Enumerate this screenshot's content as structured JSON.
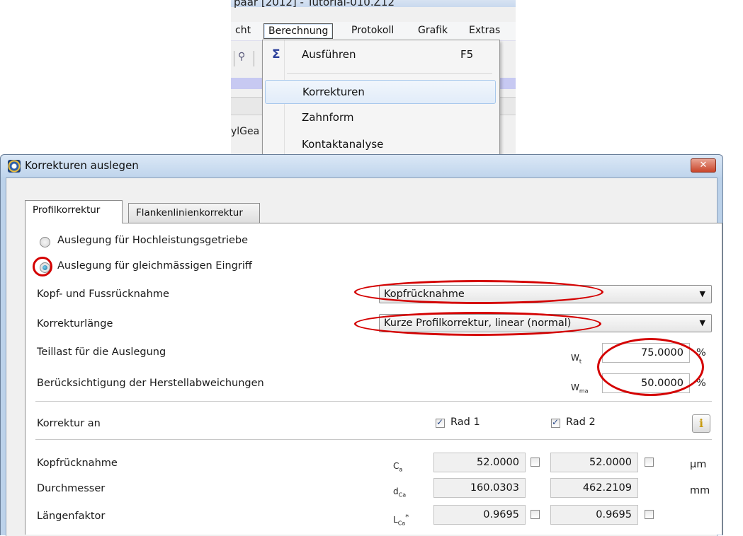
{
  "background_window": {
    "title": "paar [2012] - Tutorial-010.Z12",
    "menu": [
      "cht",
      "Berechnung",
      "Protokoll",
      "Grafik",
      "Extras"
    ],
    "tree_fragment": "ylGea"
  },
  "dropdown_menu": {
    "items": [
      {
        "label": "Ausführen",
        "shortcut": "F5",
        "icon": "sigma-icon"
      },
      {
        "label": "Korrekturen",
        "shortcut": ""
      },
      {
        "label": "Zahnform",
        "shortcut": ""
      },
      {
        "label": "Kontaktanalyse",
        "shortcut": ""
      }
    ]
  },
  "dialog": {
    "title": "Korrekturen auslegen",
    "close_label": "✕",
    "tabs": [
      "Profilkorrektur",
      "Flankenlinienkorrektur"
    ],
    "radio_options": [
      {
        "label": "Auslegung für Hochleistungsgetriebe",
        "checked": false
      },
      {
        "label": "Auslegung für gleichmässigen Eingriff",
        "checked": true
      }
    ],
    "kopf_fuss": {
      "label": "Kopf- und Fussrücknahme",
      "value": "Kopfrücknahme"
    },
    "korrekturlaenge": {
      "label": "Korrekturlänge",
      "value": "Kurze Profilkorrektur, linear (normal)"
    },
    "teillast": {
      "label": "Teillast für die Auslegung",
      "symbol": "W",
      "symbol_sub": "t",
      "value": "75.0000",
      "unit": "%"
    },
    "herstell": {
      "label": "Berücksichtigung der Herstellabweichungen",
      "symbol": "W",
      "symbol_sub": "ma",
      "value": "50.0000",
      "unit": "%"
    },
    "korrektur_an": {
      "label": "Korrektur an",
      "rad1": "Rad 1",
      "rad2": "Rad 2",
      "rad1_checked": true,
      "rad2_checked": true,
      "info_icon": "info-icon"
    },
    "rows": [
      {
        "label": "Kopfrücknahme",
        "symbol": "C",
        "symbol_sub": "a",
        "v1": "52.0000",
        "v2": "52.0000",
        "unit": "µm",
        "checkbox": true
      },
      {
        "label": "Durchmesser",
        "symbol": "d",
        "symbol_sub": "Ca",
        "v1": "160.0303",
        "v2": "462.2109",
        "unit": "mm",
        "checkbox": false
      },
      {
        "label": "Längenfaktor",
        "symbol": "L",
        "symbol_sub": "Ca",
        "symbol_sup": "*",
        "v1": "0.9695",
        "v2": "0.9695",
        "unit": "",
        "checkbox": true
      }
    ],
    "highlight_color": "#d40000"
  }
}
